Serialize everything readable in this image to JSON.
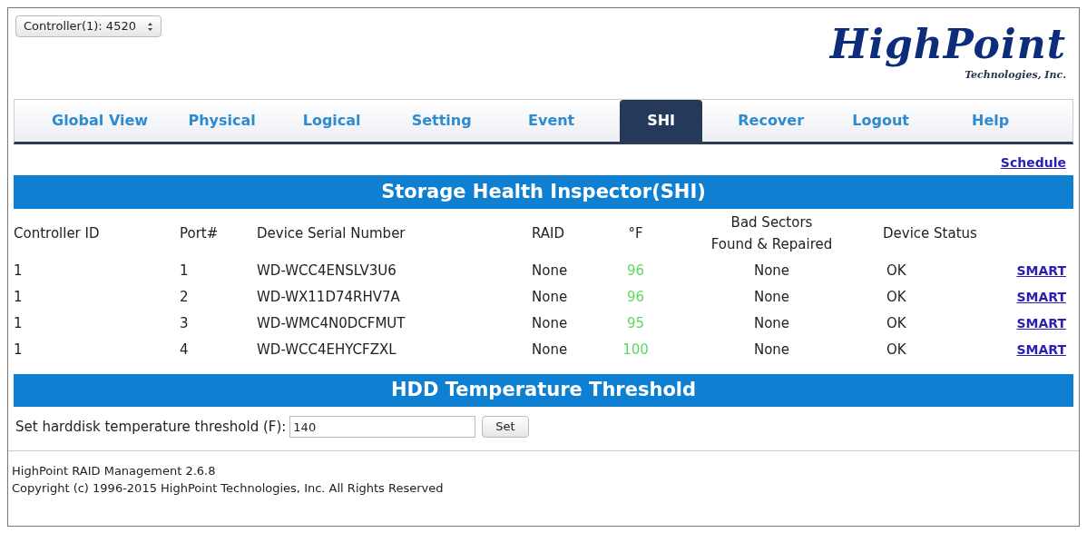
{
  "controller_select": {
    "value": "Controller(1): 4520"
  },
  "logo": {
    "name": "HighPoint",
    "tagline": "Technologies, Inc."
  },
  "tabs": [
    {
      "label": "Global View",
      "selected": false
    },
    {
      "label": "Physical",
      "selected": false
    },
    {
      "label": "Logical",
      "selected": false
    },
    {
      "label": "Setting",
      "selected": false
    },
    {
      "label": "Event",
      "selected": false
    },
    {
      "label": "SHI",
      "selected": true
    },
    {
      "label": "Recover",
      "selected": false
    },
    {
      "label": "Logout",
      "selected": false
    },
    {
      "label": "Help",
      "selected": false
    }
  ],
  "schedule_link": "Schedule",
  "shi_section": {
    "title": "Storage Health Inspector(SHI)",
    "columns": [
      "Controller ID",
      "Port#",
      "Device Serial Number",
      "RAID",
      "°F",
      "Bad Sectors\nFound & Repaired",
      "Device Status"
    ],
    "rows": [
      {
        "controller_id": "1",
        "port": "1",
        "serial": "WD-WCC4ENSLV3U6",
        "raid": "None",
        "temp": "96",
        "bad_sectors": "None",
        "status": "OK",
        "link": "SMART"
      },
      {
        "controller_id": "1",
        "port": "2",
        "serial": "WD-WX11D74RHV7A",
        "raid": "None",
        "temp": "96",
        "bad_sectors": "None",
        "status": "OK",
        "link": "SMART"
      },
      {
        "controller_id": "1",
        "port": "3",
        "serial": "WD-WMC4N0DCFMUT",
        "raid": "None",
        "temp": "95",
        "bad_sectors": "None",
        "status": "OK",
        "link": "SMART"
      },
      {
        "controller_id": "1",
        "port": "4",
        "serial": "WD-WCC4EHYCFZXL",
        "raid": "None",
        "temp": "100",
        "bad_sectors": "None",
        "status": "OK",
        "link": "SMART"
      }
    ]
  },
  "threshold_section": {
    "title": "HDD Temperature Threshold",
    "label": "Set harddisk temperature threshold (F):",
    "value": "140",
    "button": "Set"
  },
  "footer": [
    "HighPoint RAID Management 2.6.8",
    "Copyright (c) 1996-2015 HighPoint Technologies, Inc. All Rights Reserved"
  ]
}
